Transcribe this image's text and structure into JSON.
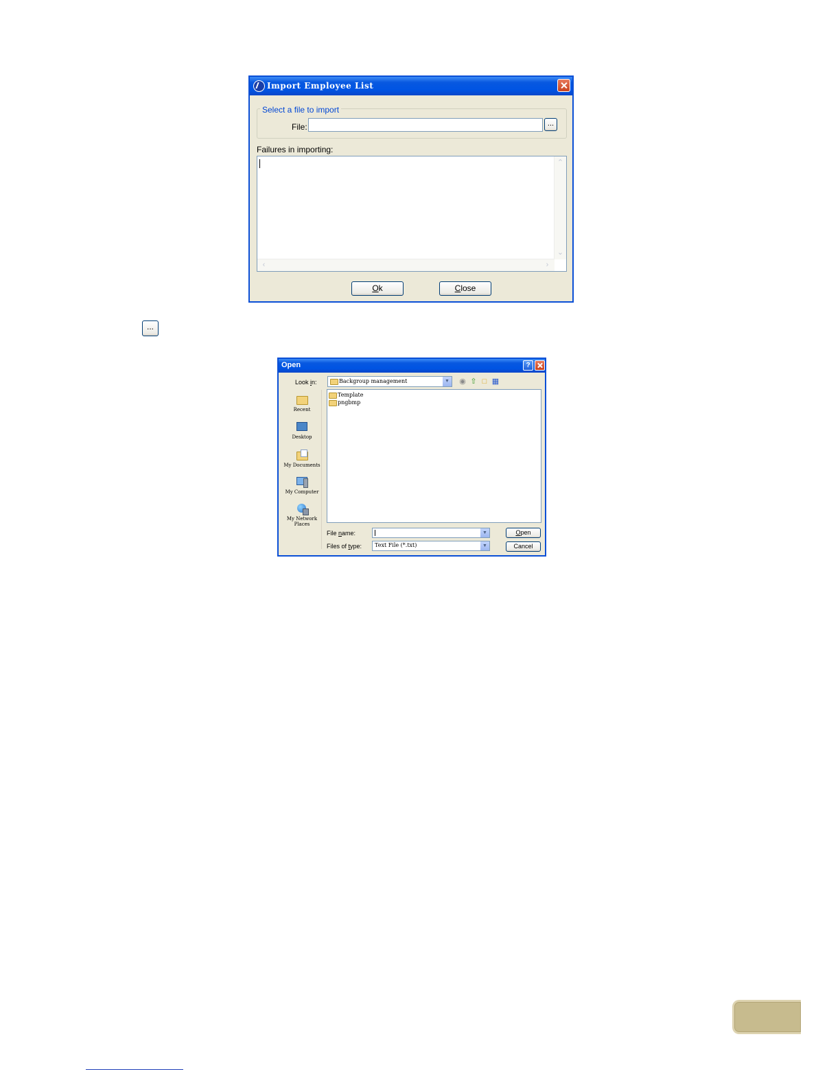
{
  "import_dialog": {
    "title": "Import Employee List",
    "group_label": "Select a file to import",
    "file_label": "File:",
    "file_value": "",
    "browse_label": "...",
    "failures_label": "Failures in importing:",
    "ok_prefix": "",
    "ok_mnemonic": "O",
    "ok_rest": "k",
    "close_prefix": "",
    "close_mnemonic": "C",
    "close_rest": "lose"
  },
  "standalone_button": {
    "label": "..."
  },
  "open_dialog": {
    "title": "Open",
    "help_label": "?",
    "look_in_prefix": "Look ",
    "look_in_mnemonic": "i",
    "look_in_rest": "n:",
    "look_in_value": "Backgroup management",
    "places": [
      {
        "label": "Recent",
        "icon": "recent-folder-icon"
      },
      {
        "label": "Desktop",
        "icon": "desktop-icon"
      },
      {
        "label": "My Documents",
        "icon": "my-documents-icon"
      },
      {
        "label": "My Computer",
        "icon": "my-computer-icon"
      },
      {
        "label": "My Network Places",
        "icon": "network-places-icon"
      }
    ],
    "files": [
      {
        "name": "Template",
        "icon": "folder-icon"
      },
      {
        "name": "pngbmp",
        "icon": "folder-icon"
      }
    ],
    "file_name_prefix": "File ",
    "file_name_mnemonic": "n",
    "file_name_rest": "ame:",
    "file_name_value": "",
    "files_of_type_prefix": "Files of ",
    "files_of_type_mnemonic": "t",
    "files_of_type_rest": "ype:",
    "files_of_type_value": "Text File (*.txt)",
    "open_mnemonic": "O",
    "open_rest": "pen",
    "cancel_label": "Cancel"
  },
  "colors": {
    "titlebar": "#0054e3",
    "dialog_bg": "#ece9d8",
    "group_label": "#0046d5",
    "page_tab": "#c7bb8e"
  }
}
